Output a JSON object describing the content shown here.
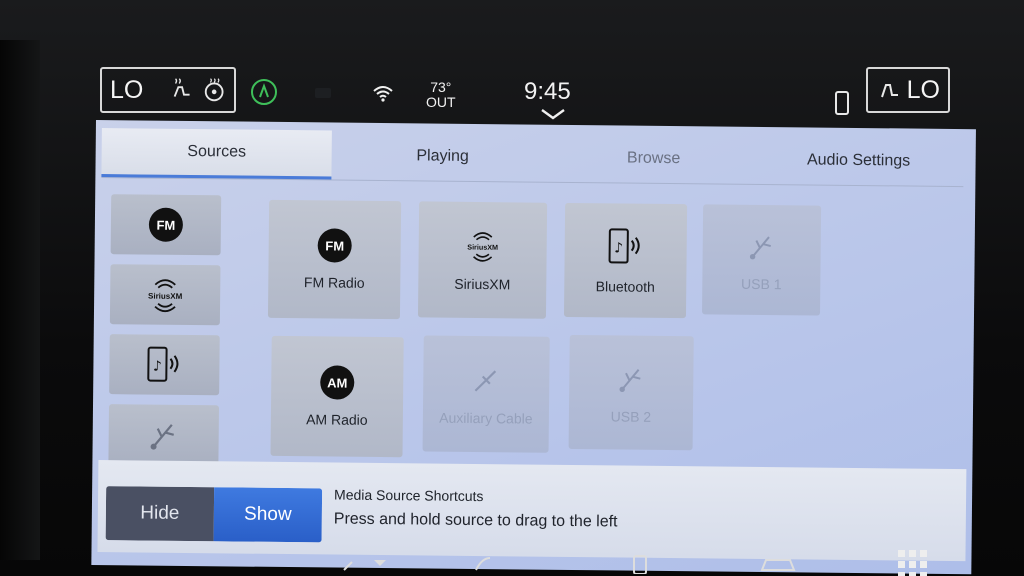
{
  "status_bar": {
    "left_climate": "LO",
    "right_climate": "LO",
    "temperature": "73°",
    "temperature_label": "OUT",
    "time": "9:45"
  },
  "tabs": [
    {
      "label": "Sources",
      "active": true
    },
    {
      "label": "Playing",
      "active": false
    },
    {
      "label": "Browse",
      "active": false
    },
    {
      "label": "Audio Settings",
      "active": false
    }
  ],
  "shortcuts": [
    {
      "icon": "fm-icon",
      "badge": "FM"
    },
    {
      "icon": "siriusxm-icon",
      "brand": "SiriusXM"
    },
    {
      "icon": "bluetooth-phone-icon"
    },
    {
      "icon": "usb-icon"
    }
  ],
  "sources": [
    {
      "label": "FM Radio",
      "icon": "fm-icon",
      "badge": "FM",
      "enabled": true
    },
    {
      "label": "SiriusXM",
      "icon": "siriusxm-icon",
      "brand": "SiriusXM",
      "enabled": true
    },
    {
      "label": "Bluetooth",
      "icon": "bluetooth-phone-icon",
      "enabled": true
    },
    {
      "label": "USB 1",
      "icon": "usb-icon",
      "enabled": false
    },
    {
      "label": "AM Radio",
      "icon": "am-icon",
      "badge": "AM",
      "enabled": true
    },
    {
      "label": "Auxiliary Cable",
      "icon": "aux-cable-icon",
      "enabled": false
    },
    {
      "label": "USB 2",
      "icon": "usb-icon",
      "enabled": false
    }
  ],
  "bottom_bar": {
    "hide_label": "Hide",
    "show_label": "Show",
    "selected": "Show",
    "hint_title": "Media Source Shortcuts",
    "hint_text": "Press and hold source to drag to the left"
  },
  "colors": {
    "accent": "#3f7ae0",
    "screen_bg": "#bcc8ea",
    "tile_bg": "#b8bfcc"
  }
}
